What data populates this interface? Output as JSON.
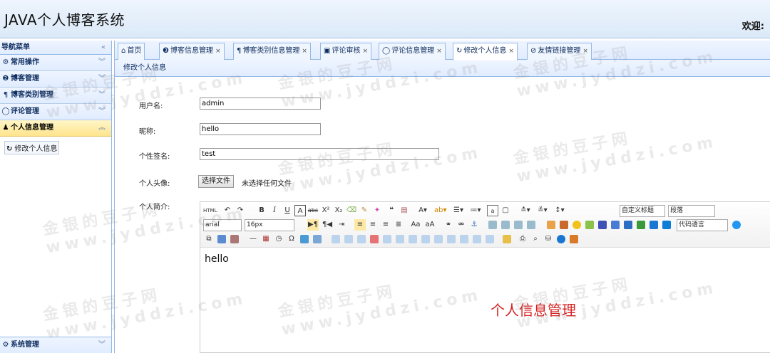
{
  "header": {
    "title": "JAVA个人博客系统",
    "welcome": "欢迎:"
  },
  "sidebar": {
    "head": "导航菜单",
    "collapse_icon": "«",
    "items": [
      {
        "label": "常用操作",
        "icon": "⚙"
      },
      {
        "label": "博客管理",
        "icon": "❷"
      },
      {
        "label": "博客类别管理",
        "icon": "¶"
      },
      {
        "label": "评论管理",
        "icon": "◯"
      },
      {
        "label": "个人信息管理",
        "icon": "♟"
      }
    ],
    "sub_link": "修改个人信息",
    "bottom_item": "系统管理"
  },
  "tabs": [
    {
      "label": "首页",
      "icon": "⌂",
      "closable": false
    },
    {
      "label": "博客信息管理",
      "icon": "❸",
      "closable": true
    },
    {
      "label": "博客类别信息管理",
      "icon": "¶",
      "closable": true
    },
    {
      "label": "评论审核",
      "icon": "▣",
      "closable": true
    },
    {
      "label": "评论信息管理",
      "icon": "◯",
      "closable": true
    },
    {
      "label": "修改个人信息",
      "icon": "↻",
      "closable": true
    },
    {
      "label": "友情链接管理",
      "icon": "⊘",
      "closable": true
    }
  ],
  "close_glyph": "×",
  "panel_title": "修改个人信息",
  "form": {
    "username_label": "用户名:",
    "username_value": "admin",
    "nickname_label": "昵称:",
    "nickname_value": "hello",
    "signature_label": "个性签名:",
    "signature_value": "test",
    "avatar_label": "个人头像:",
    "file_button": "选择文件",
    "file_status": "未选择任何文件",
    "intro_label": "个人简介:"
  },
  "editor": {
    "content": "hello",
    "title_select": "自定义标题",
    "paragraph_select": "段落",
    "font_select": "arial",
    "size_select": "16px",
    "code_select": "代码语言",
    "html_label": "HTML"
  },
  "overlay_caption": "个人信息管理",
  "watermark_line1": "金银的豆子网",
  "watermark_line2": "www.jyddzi.com",
  "colors": {
    "header_bg": "#dbe9f8",
    "border": "#95b8e7",
    "active_item": "#ffe48d",
    "caption": "#d62020"
  }
}
